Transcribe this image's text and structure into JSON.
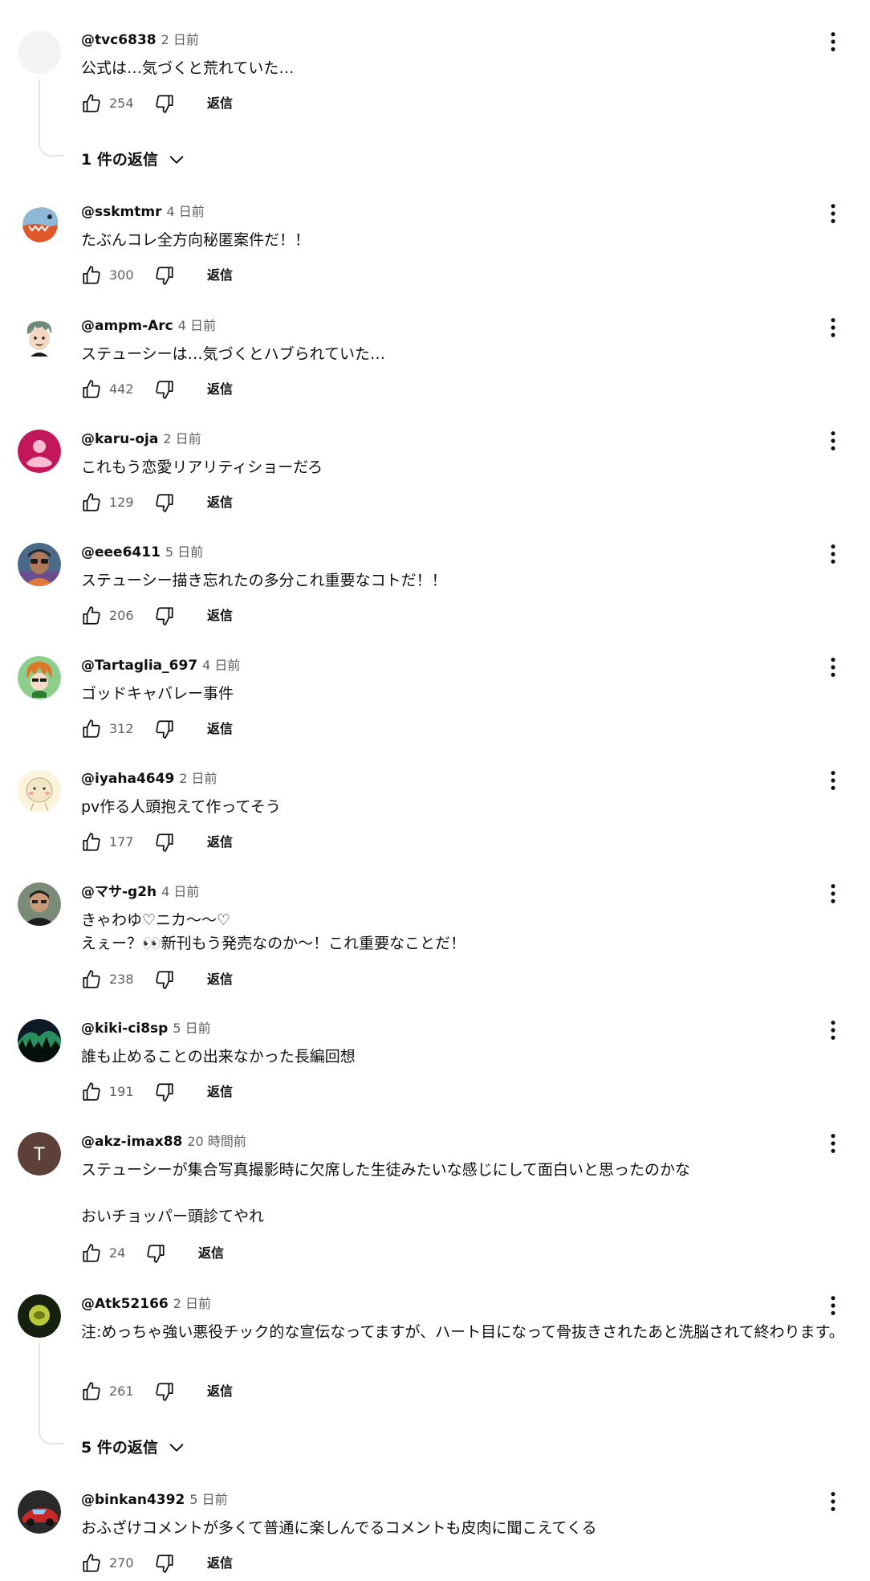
{
  "ui": {
    "reply_label": "返信"
  },
  "comments": [
    {
      "handle": "@tvc6838",
      "time": "2 日前",
      "lines": [
        "公式は…気づくと荒れていた…"
      ],
      "likes": "254",
      "replies": "1 件の返信",
      "avatar": "blank"
    },
    {
      "handle": "@sskmtmr",
      "time": "4 日前",
      "lines": [
        "たぶんコレ全方向秘匿案件だ！！"
      ],
      "likes": "300",
      "avatar": "shark"
    },
    {
      "handle": "@ampm-Arc",
      "time": "4 日前",
      "lines": [
        "ステューシーは…気づくとハブられていた…"
      ],
      "likes": "442",
      "avatar": "cartoon-face"
    },
    {
      "handle": "@karu-oja",
      "time": "2 日前",
      "lines": [
        "これもう恋愛リアリティショーだろ"
      ],
      "likes": "129",
      "avatar": "default-person"
    },
    {
      "handle": "@eee6411",
      "time": "5 日前",
      "lines": [
        "ステューシー描き忘れたの多分これ重要なコトだ！！"
      ],
      "likes": "206",
      "avatar": "photo-man"
    },
    {
      "handle": "@Tartaglia_697",
      "time": "4 日前",
      "lines": [
        "ゴッドキャバレー事件"
      ],
      "likes": "312",
      "avatar": "cartoon-orange"
    },
    {
      "handle": "@iyaha4649",
      "time": "2 日前",
      "lines": [
        "pv作る人頭抱えて作ってそう"
      ],
      "likes": "177",
      "avatar": "cartoon-cream"
    },
    {
      "handle": "@マサ-g2h",
      "time": "4 日前",
      "lines": [
        "きゃわゆ♡ニカ〜〜♡",
        "えぇー？👀新刊もう発売なのか〜！これ重要なことだ！"
      ],
      "likes": "238",
      "avatar": "photo-person"
    },
    {
      "handle": "@kiki-ci8sp",
      "time": "5 日前",
      "lines": [
        "誰も止めることの出来なかった長編回想"
      ],
      "likes": "191",
      "avatar": "aurora"
    },
    {
      "handle": "@akz-imax88",
      "time": "20 時間前",
      "lines": [
        "ステューシーが集合写真撮影時に欠席した生徒みたいな感じにして面白いと思ったのかな",
        "",
        "おいチョッパー頭診てやれ"
      ],
      "likes": "24",
      "avatar": "letter",
      "avatar_letter": "T",
      "avatar_color": "#5d4037"
    },
    {
      "handle": "@Atk52166",
      "time": "2 日前",
      "lines": [
        "注:めっちゃ強い悪役チック的な宣伝なってますが、ハート目になって骨抜きされたあと洗脳されて終わります。"
      ],
      "likes": "261",
      "replies": "5 件の返信",
      "avatar": "dark-green"
    },
    {
      "handle": "@binkan4392",
      "time": "5 日前",
      "lines": [
        "おふざけコメントが多くて普通に楽しんでるコメントも皮肉に聞こえてくる"
      ],
      "likes": "270",
      "avatar": "photo-car"
    }
  ]
}
